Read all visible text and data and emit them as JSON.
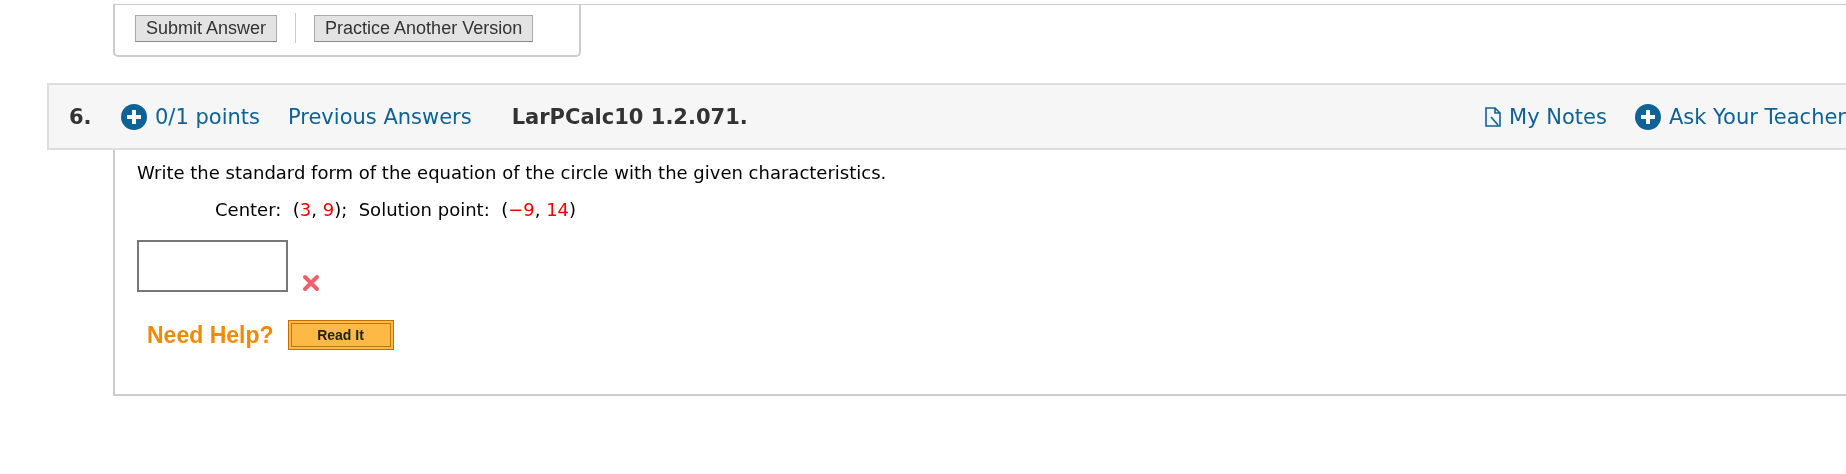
{
  "previous_actions": {
    "buttons": [
      "Submit Answer",
      "Practice Another Version"
    ]
  },
  "question": {
    "number": "6.",
    "points": "0/1 points",
    "previous_answers": "Previous Answers",
    "source": "LarPCalc10 1.2.071.",
    "my_notes": "My Notes",
    "ask_teacher": "Ask Your Teacher",
    "prompt": "Write the standard form of the equation of the circle with the given characteristics.",
    "given": [
      {
        "text": "Center:  (",
        "highlight": false
      },
      {
        "text": "3",
        "highlight": true
      },
      {
        "text": ", ",
        "highlight": false
      },
      {
        "text": "9",
        "highlight": true
      },
      {
        "text": ");  Solution point:  (",
        "highlight": false
      },
      {
        "text": "−9",
        "highlight": true
      },
      {
        "text": ", ",
        "highlight": false
      },
      {
        "text": "14",
        "highlight": true
      },
      {
        "text": ")",
        "highlight": false
      }
    ],
    "answer": {
      "correct": false
    },
    "need_help": "Need Help?",
    "help_buttons": [
      "Read It"
    ]
  }
}
